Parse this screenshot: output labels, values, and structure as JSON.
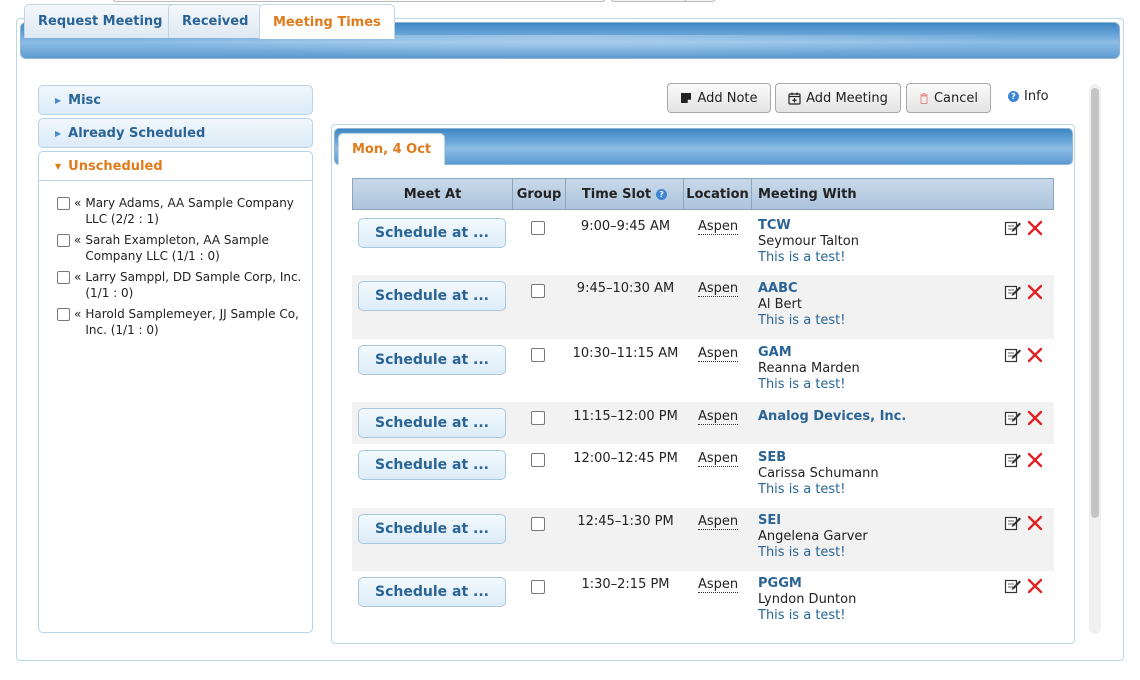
{
  "tabs": [
    {
      "label": "Request Meeting",
      "active": false
    },
    {
      "label": "Received",
      "active": false
    },
    {
      "label": "Meeting Times",
      "active": true
    }
  ],
  "sidebar": {
    "sections": [
      {
        "label": "Misc",
        "open": false
      },
      {
        "label": "Already Scheduled",
        "open": false
      },
      {
        "label": "Unscheduled",
        "open": true
      }
    ],
    "unscheduled": [
      {
        "prefix": "«",
        "text": "Mary Adams, AA Sample Company LLC (2/2 : 1)"
      },
      {
        "prefix": "«",
        "text": "Sarah Exampleton, AA Sample Company LLC (1/1 : 0)"
      },
      {
        "prefix": "«",
        "text": "Larry Samppl, DD Sample Corp, Inc. (1/1 : 0)"
      },
      {
        "prefix": "«",
        "text": "Harold Samplemeyer, JJ Sample Co, Inc. (1/1 : 0)"
      }
    ]
  },
  "toolbar": {
    "add_note": "Add Note",
    "add_meeting": "Add Meeting",
    "cancel": "Cancel",
    "info": "Info"
  },
  "day_tab": "Mon, 4 Oct",
  "table": {
    "headers": [
      "Meet At",
      "Group",
      "Time Slot",
      "Location",
      "Meeting With"
    ],
    "rows": [
      {
        "button": "Schedule at ...",
        "time": "9:00–9:45 AM",
        "location": "Aspen",
        "org": "TCW",
        "person": "Seymour Talton",
        "note": "This is a test!"
      },
      {
        "button": "Schedule at ...",
        "time": "9:45–10:30 AM",
        "location": "Aspen",
        "org": "AABC",
        "person": "Al Bert",
        "note": "This is a test!"
      },
      {
        "button": "Schedule at ...",
        "time": "10:30–11:15 AM",
        "location": "Aspen",
        "org": "GAM",
        "person": "Reanna Marden",
        "note": "This is a test!"
      },
      {
        "button": "Schedule at ...",
        "time": "11:15–12:00 PM",
        "location": "Aspen",
        "org": "Analog Devices, Inc.",
        "person": "",
        "note": ""
      },
      {
        "button": "Schedule at ...",
        "time": "12:00–12:45 PM",
        "location": "Aspen",
        "org": "SEB",
        "person": "Carissa Schumann",
        "note": "This is a test!"
      },
      {
        "button": "Schedule at ...",
        "time": "12:45–1:30 PM",
        "location": "Aspen",
        "org": "SEI",
        "person": "Angelena Garver",
        "note": "This is a test!"
      },
      {
        "button": "Schedule at ...",
        "time": "1:30–2:15 PM",
        "location": "Aspen",
        "org": "PGGM",
        "person": "Lyndon Dunton",
        "note": "This is a test!"
      }
    ]
  },
  "colors": {
    "link_blue": "#2a6496",
    "active_orange": "#e07b1c",
    "delete_red": "#e02020",
    "help_blue": "#3d86d6"
  },
  "icons": {
    "time_slot_help": "question-circle-icon",
    "info": "question-circle-icon",
    "add_note": "note-icon",
    "add_meeting": "calendar-plus-icon",
    "cancel": "trash-icon",
    "edit": "edit-icon",
    "delete": "delete-x-icon"
  }
}
